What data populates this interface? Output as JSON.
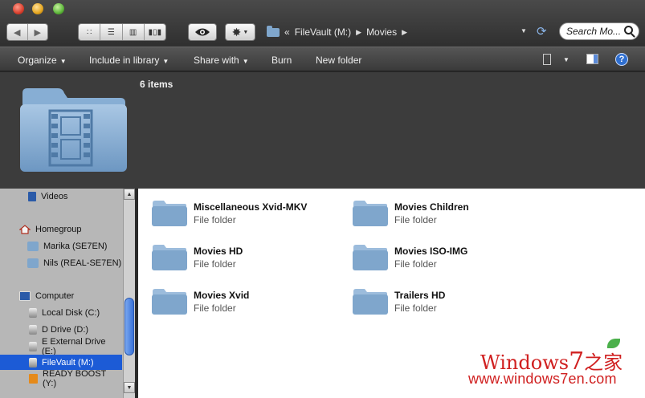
{
  "window": {
    "traffic_lights": [
      "close",
      "minimize",
      "zoom"
    ]
  },
  "toolbar": {
    "nav_back_icon": "arrow-left",
    "nav_forward_icon": "arrow-right",
    "view_modes": [
      "icon-view",
      "list-view",
      "column-view",
      "coverflow-view"
    ],
    "quicklook_icon": "eye",
    "action_icon": "gear"
  },
  "address": {
    "overflow": "«",
    "crumbs": [
      "FileVault (M:)",
      "Movies"
    ]
  },
  "search": {
    "placeholder": "Search Mo..."
  },
  "command_bar": {
    "organize": "Organize",
    "include_in_library": "Include in library",
    "share_with": "Share with",
    "burn": "Burn",
    "new_folder": "New folder",
    "help": "?"
  },
  "header": {
    "items_count": "6 items"
  },
  "sidebar": {
    "items": [
      {
        "label": "Videos",
        "icon": "videos-icon"
      },
      {
        "label": "Homegroup",
        "icon": "home-icon"
      },
      {
        "label": "Marika (SE7EN)",
        "icon": "folder-icon"
      },
      {
        "label": "Nils (REAL-SE7EN)",
        "icon": "folder-icon"
      },
      {
        "label": "Computer",
        "icon": "computer-icon"
      },
      {
        "label": "Local Disk (C:)",
        "icon": "drive-icon"
      },
      {
        "label": "D Drive (D:)",
        "icon": "drive-icon"
      },
      {
        "label": "E External Drive (E:)",
        "icon": "drive-icon"
      },
      {
        "label": "FileVault (M:)",
        "icon": "drive-icon",
        "selected": true
      },
      {
        "label": "READY BOOST (Y:)",
        "icon": "boost-icon"
      }
    ]
  },
  "content": {
    "items": [
      {
        "name": "Miscellaneous Xvid-MKV",
        "type": "File folder"
      },
      {
        "name": "Movies Children",
        "type": "File folder"
      },
      {
        "name": "Movies HD",
        "type": "File folder"
      },
      {
        "name": "Movies ISO-IMG",
        "type": "File folder"
      },
      {
        "name": "Movies Xvid",
        "type": "File folder"
      },
      {
        "name": "Trailers HD",
        "type": "File folder"
      }
    ]
  },
  "watermark": {
    "brand_prefix": "Windows",
    "brand_seven": "7",
    "brand_suffix": "之家",
    "url": "www.windows7en.com"
  },
  "colors": {
    "selection": "#1c5bd6",
    "folder": "#7fa6cc",
    "watermark": "#d02020"
  }
}
